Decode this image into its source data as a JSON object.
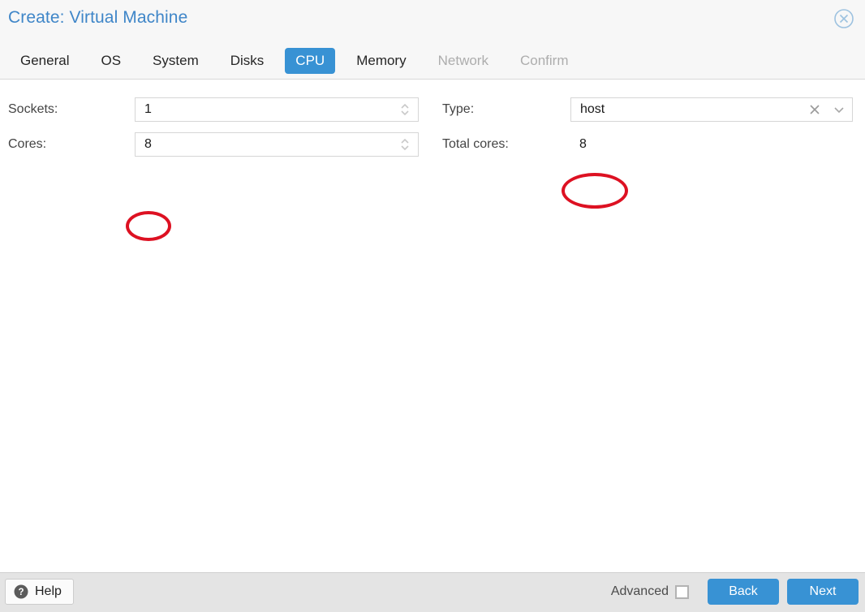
{
  "window": {
    "title": "Create: Virtual Machine",
    "close_icon": "close-circle-icon"
  },
  "tabs": [
    {
      "label": "General",
      "state": "enabled"
    },
    {
      "label": "OS",
      "state": "enabled"
    },
    {
      "label": "System",
      "state": "enabled"
    },
    {
      "label": "Disks",
      "state": "enabled"
    },
    {
      "label": "CPU",
      "state": "active"
    },
    {
      "label": "Memory",
      "state": "enabled"
    },
    {
      "label": "Network",
      "state": "disabled"
    },
    {
      "label": "Confirm",
      "state": "disabled"
    }
  ],
  "form": {
    "sockets": {
      "label": "Sockets:",
      "value": "1",
      "spinner_icon": "stepper-arrows-icon"
    },
    "cores": {
      "label": "Cores:",
      "value": "8",
      "spinner_icon": "stepper-arrows-icon"
    },
    "type": {
      "label": "Type:",
      "value": "host",
      "clear_icon": "clear-x-icon",
      "dropdown_icon": "chevron-down-icon"
    },
    "total_cores": {
      "label": "Total cores:",
      "value": "8"
    }
  },
  "annotations": [
    {
      "target": "cores-value",
      "shape": "ellipse",
      "color": "#dd1122"
    },
    {
      "target": "type-value",
      "shape": "ellipse",
      "color": "#dd1122"
    }
  ],
  "footer": {
    "help_label": "Help",
    "help_icon": "question-mark-circle-icon",
    "advanced_label": "Advanced",
    "advanced_checked": false,
    "back_label": "Back",
    "next_label": "Next"
  },
  "colors": {
    "accent_blue": "#3892d4",
    "title_blue": "#3f86c8",
    "annotation_red": "#dd1122",
    "header_bg": "#f7f7f7",
    "footer_bg": "#e4e4e4"
  }
}
